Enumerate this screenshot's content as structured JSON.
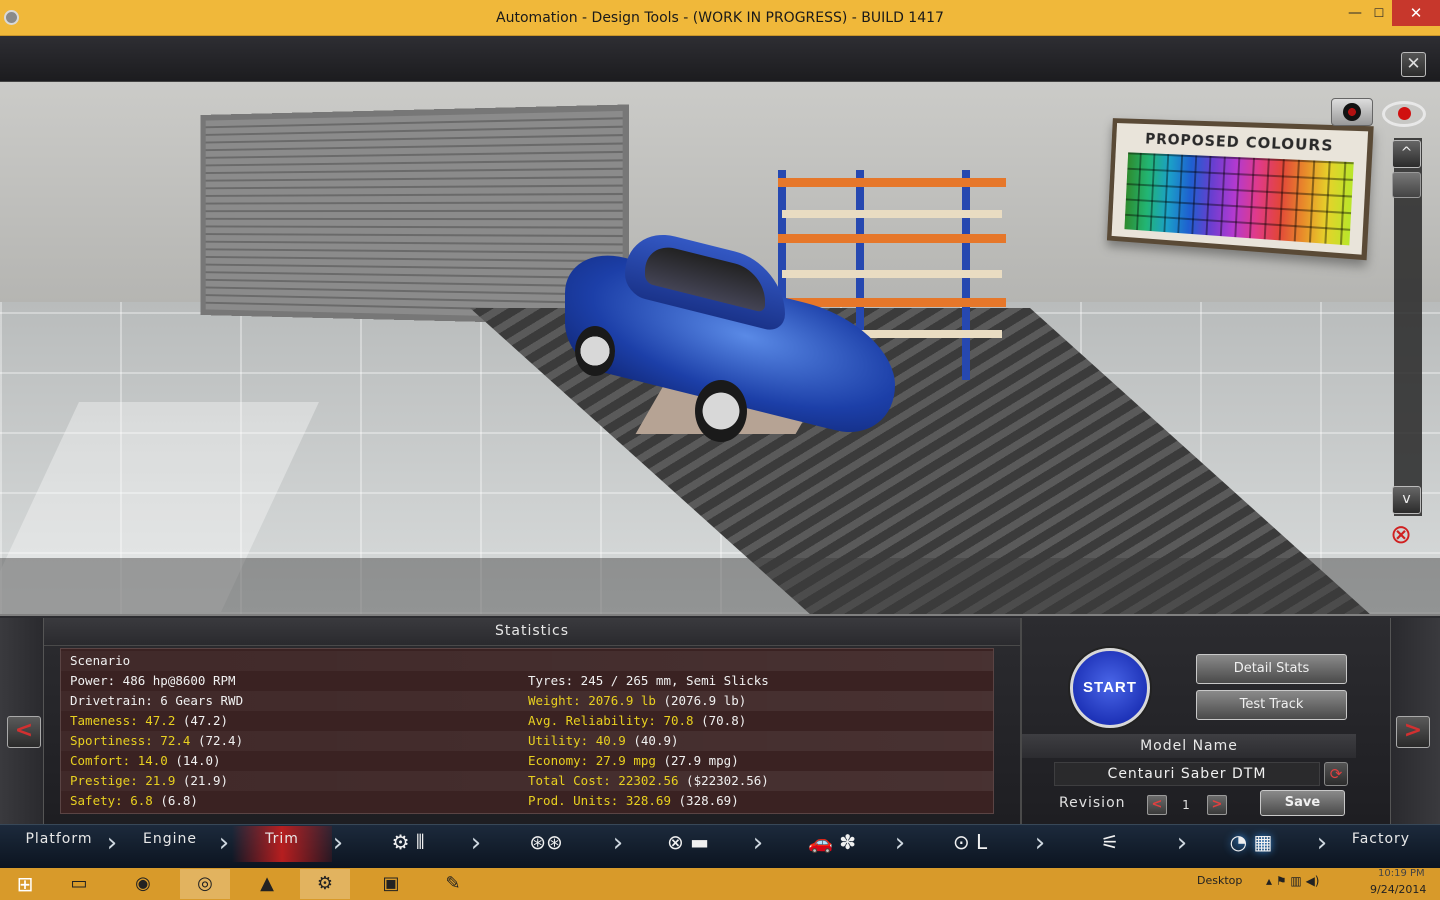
{
  "window": {
    "title": "Automation - Design Tools - (WORK IN PROGRESS) - BUILD 1417",
    "minimize": "—",
    "maximize": "☐",
    "close": "✕"
  },
  "viewport": {
    "close_label": "✕",
    "colour_board_title": "PROPOSED COLOURS",
    "scroll_up": "^",
    "scroll_down": "v",
    "hide_icon": "⊗"
  },
  "statistics": {
    "title": "Statistics",
    "left": [
      {
        "label": "Scenario",
        "highlight": false
      },
      {
        "label": "Power: 486 hp@8600 RPM",
        "highlight": false
      },
      {
        "label": "Drivetrain: 6 Gears RWD",
        "highlight": false
      },
      {
        "label": "Tameness: 47.2",
        "value": " (47.2)",
        "highlight": true
      },
      {
        "label": "Sportiness: 72.4",
        "value": " (72.4)",
        "highlight": true
      },
      {
        "label": "Comfort: 14.0",
        "value": " (14.0)",
        "highlight": true
      },
      {
        "label": "Prestige: 21.9",
        "value": " (21.9)",
        "highlight": true
      },
      {
        "label": "Safety: 6.8",
        "value": " (6.8)",
        "highlight": true
      }
    ],
    "right": [
      {
        "label": "Tyres: 245 / 265 mm, Semi Slicks",
        "highlight": false
      },
      {
        "label": "Weight: 2076.9 lb",
        "value": " (2076.9 lb)",
        "highlight": true
      },
      {
        "label": "Avg. Reliability: 70.8",
        "value": " (70.8)",
        "highlight": true
      },
      {
        "label": "Utility: 40.9",
        "value": " (40.9)",
        "highlight": true
      },
      {
        "label": "Economy: 27.9 mpg",
        "value": " (27.9 mpg)",
        "highlight": true
      },
      {
        "label": "Total Cost: 22302.56",
        "value": " ($22302.56)",
        "highlight": true
      },
      {
        "label": "Prod. Units: 328.69",
        "value": " (328.69)",
        "highlight": true
      }
    ]
  },
  "controls": {
    "start_label": "START",
    "detail_stats_label": "Detail Stats",
    "test_track_label": "Test Track",
    "model_name_label": "Model Name",
    "model_name_value": "Centauri Saber DTM",
    "revision_label": "Revision",
    "revision_prev": "<",
    "revision_value": "1",
    "revision_next": ">",
    "save_label": "Save",
    "nav_prev": "<",
    "nav_next": ">"
  },
  "tabs": {
    "platform": "Platform",
    "engine": "Engine",
    "trim": "Trim",
    "factory": "Factory",
    "active": "trim",
    "icon_gearbox": "⚙ ⫴",
    "icon_wheels": "⊛⊛",
    "icon_brakes": "⊗ ▬",
    "icon_body": "🚗 ✽",
    "icon_interior": "⊙ L",
    "icon_exhaust": "⚟",
    "icon_test": "◔ ▦"
  },
  "taskbar": {
    "desktop_label": "Desktop",
    "date": "9/24/2014",
    "time": "10:19 PM",
    "apps": [
      "file-explorer",
      "firefox",
      "steam-big-picture",
      "vlc",
      "steam",
      "7-zip",
      "paint"
    ]
  }
}
